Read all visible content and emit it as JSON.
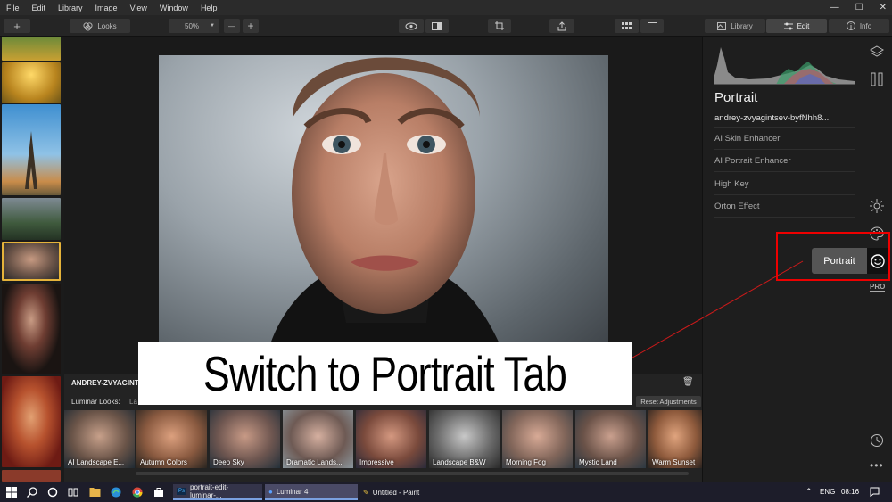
{
  "menubar": {
    "items": [
      "File",
      "Edit",
      "Library",
      "Image",
      "View",
      "Window",
      "Help"
    ],
    "minimize": "—",
    "maximize": "☐",
    "close": "✕"
  },
  "toolbar": {
    "add_label": "+",
    "looks_label": "Looks",
    "zoom_value": "50%",
    "zoom_out": "—",
    "zoom_in": "+",
    "tabs": {
      "library": "Library",
      "edit": "Edit",
      "info": "Info"
    }
  },
  "looks_panel": {
    "image_name": "ANDREY-ZVYAGINTSEV",
    "looks_title": "Luminar Looks:",
    "category_stub": "La",
    "reset_label": "Reset Adjustments",
    "looks": [
      "AI Landscape E...",
      "Autumn Colors",
      "Deep Sky",
      "Dramatic Lands...",
      "Impressive",
      "Landscape B&W",
      "Morning Fog",
      "Mystic Land",
      "Warm Sunset"
    ]
  },
  "right_panel": {
    "section_title": "Portrait",
    "filename": "andrey-zvyagintsev-byfNhh8...",
    "tools": [
      "AI Skin Enhancer",
      "AI Portrait Enhancer",
      "High Key",
      "Orton Effect"
    ],
    "pro_label": "PRO"
  },
  "overlay": {
    "callout_text": "Switch to Portrait Tab",
    "tooltip_text": "Portrait"
  },
  "taskbar": {
    "tasks": [
      "portrait-edit-luminar-...",
      "Luminar 4",
      "Untitled - Paint"
    ],
    "language": "ENG",
    "time": "08:16"
  }
}
